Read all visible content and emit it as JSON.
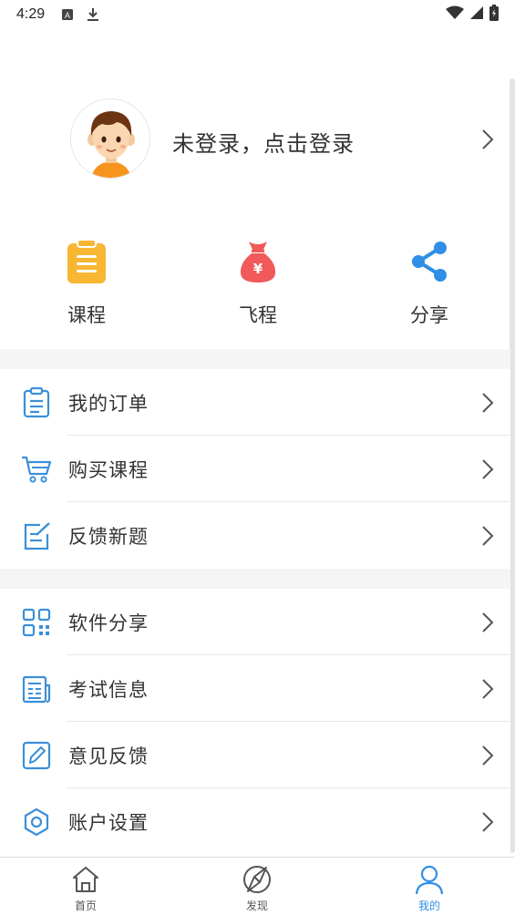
{
  "status_bar": {
    "time": "4:29"
  },
  "profile": {
    "login_text": "未登录，点击登录"
  },
  "quick_actions": [
    {
      "label": "课程",
      "icon": "clipboard-icon",
      "color": "#f7b733"
    },
    {
      "label": "飞程",
      "icon": "money-bag-icon",
      "color": "#f05a5a"
    },
    {
      "label": "分享",
      "icon": "share-icon",
      "color": "#2f8fe6"
    }
  ],
  "menu_group_1": [
    {
      "label": "我的订单",
      "icon": "order-list-icon"
    },
    {
      "label": "购买课程",
      "icon": "cart-icon"
    },
    {
      "label": "反馈新题",
      "icon": "edit-note-icon"
    }
  ],
  "menu_group_2": [
    {
      "label": "软件分享",
      "icon": "qr-code-icon"
    },
    {
      "label": "考试信息",
      "icon": "newspaper-icon"
    },
    {
      "label": "意见反馈",
      "icon": "pencil-square-icon"
    },
    {
      "label": "账户设置",
      "icon": "settings-icon"
    }
  ],
  "bottom_nav": [
    {
      "label": "首页",
      "icon": "home-icon",
      "active": false
    },
    {
      "label": "发现",
      "icon": "discover-icon",
      "active": false
    },
    {
      "label": "我的",
      "icon": "user-icon",
      "active": true
    }
  ],
  "colors": {
    "accent": "#2f8fe6",
    "icon_blue": "#3b8fd9",
    "text": "#333333",
    "separator": "#f5f5f5"
  }
}
